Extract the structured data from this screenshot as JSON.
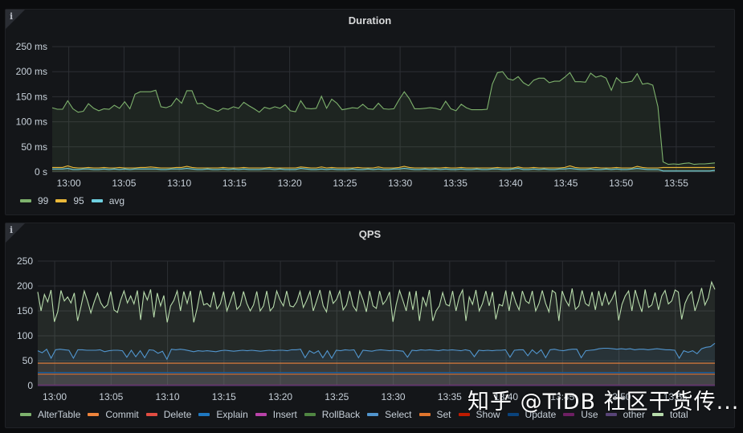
{
  "panels": [
    {
      "id": "duration",
      "title": "Duration",
      "info_icon": "info-icon",
      "legend": [
        {
          "label": "99",
          "color": "#7eb26d"
        },
        {
          "label": "95",
          "color": "#eab839"
        },
        {
          "label": "avg",
          "color": "#6ed0e0"
        }
      ]
    },
    {
      "id": "qps",
      "title": "QPS",
      "info_icon": "info-icon",
      "legend": [
        {
          "label": "AlterTable",
          "color": "#7eb26d"
        },
        {
          "label": "Commit",
          "color": "#ef843c"
        },
        {
          "label": "Delete",
          "color": "#e24d42"
        },
        {
          "label": "Explain",
          "color": "#1f78c1"
        },
        {
          "label": "Insert",
          "color": "#ba43a9"
        },
        {
          "label": "RollBack",
          "color": "#508642"
        },
        {
          "label": "Select",
          "color": "#5195ce"
        },
        {
          "label": "Set",
          "color": "#e0752d"
        },
        {
          "label": "Show",
          "color": "#bf1b00"
        },
        {
          "label": "Update",
          "color": "#0a437c"
        },
        {
          "label": "Use",
          "color": "#6d1f62"
        },
        {
          "label": "other",
          "color": "#584477"
        },
        {
          "label": "total",
          "color": "#b7dbab"
        }
      ]
    }
  ],
  "watermark": "知乎 @TiDB 社区干货传...",
  "chart_data": [
    {
      "type": "area",
      "title": "Duration",
      "xlabel": "",
      "ylabel": "",
      "x_range": [
        "12:58:30",
        "13:58:30"
      ],
      "x_ticks": [
        "13:00",
        "13:05",
        "13:10",
        "13:15",
        "13:20",
        "13:25",
        "13:30",
        "13:35",
        "13:40",
        "13:45",
        "13:50",
        "13:55"
      ],
      "y_ticks": [
        "0 s",
        "50 ms",
        "100 ms",
        "150 ms",
        "200 ms",
        "250 ms"
      ],
      "ylim": [
        0,
        250
      ],
      "y_unit": "ms",
      "grid": true,
      "legend_position": "bottom-left",
      "x_step_seconds": 30,
      "series": [
        {
          "name": "99",
          "color": "#7eb26d",
          "values": [
            128,
            125,
            125,
            142,
            126,
            119,
            121,
            136,
            127,
            122,
            126,
            125,
            133,
            127,
            140,
            126,
            155,
            160,
            160,
            160,
            163,
            130,
            128,
            132,
            147,
            137,
            162,
            162,
            136,
            137,
            129,
            125,
            121,
            127,
            125,
            130,
            127,
            139,
            132,
            126,
            119,
            129,
            126,
            130,
            127,
            134,
            122,
            120,
            142,
            127,
            126,
            127,
            151,
            127,
            145,
            137,
            124,
            126,
            128,
            127,
            135,
            126,
            125,
            137,
            126,
            125,
            126,
            144,
            160,
            146,
            126,
            126,
            127,
            128,
            127,
            124,
            141,
            126,
            122,
            135,
            128,
            124,
            124,
            124,
            125,
            175,
            198,
            200,
            186,
            183,
            190,
            178,
            172,
            183,
            187,
            187,
            178,
            181,
            181,
            189,
            198,
            180,
            180,
            179,
            197,
            189,
            192,
            187,
            163,
            188,
            178,
            179,
            181,
            196,
            175,
            177,
            173,
            130,
            20,
            15,
            16,
            15,
            17,
            18,
            15,
            16,
            16,
            17,
            18
          ]
        },
        {
          "name": "95",
          "color": "#eab839",
          "values": [
            9,
            9,
            9,
            12,
            9,
            8,
            8,
            9,
            8,
            8,
            9,
            8,
            8,
            9,
            8,
            8,
            8,
            9,
            9,
            10,
            9,
            8,
            8,
            8,
            9,
            9,
            11,
            9,
            8,
            8,
            8,
            8,
            8,
            9,
            8,
            8,
            8,
            9,
            8,
            8,
            8,
            8,
            9,
            8,
            8,
            8,
            8,
            8,
            10,
            9,
            8,
            8,
            10,
            8,
            9,
            8,
            8,
            8,
            8,
            9,
            8,
            8,
            8,
            10,
            8,
            8,
            8,
            9,
            11,
            9,
            8,
            8,
            8,
            8,
            8,
            8,
            9,
            8,
            8,
            9,
            8,
            8,
            8,
            8,
            8,
            8,
            9,
            8,
            8,
            8,
            10,
            8,
            8,
            9,
            8,
            8,
            8,
            8,
            8,
            9,
            12,
            9,
            8,
            8,
            8,
            9,
            8,
            8,
            8,
            9,
            8,
            8,
            8,
            11,
            9,
            8,
            8,
            8,
            9,
            9,
            9,
            9,
            9,
            9,
            9,
            9,
            9,
            9,
            9
          ]
        },
        {
          "name": "avg",
          "color": "#6ed0e0",
          "values": [
            6,
            6,
            6,
            7,
            5,
            5,
            6,
            6,
            5,
            5,
            6,
            5,
            6,
            5,
            6,
            5,
            6,
            6,
            6,
            6,
            6,
            5,
            5,
            6,
            6,
            6,
            7,
            6,
            5,
            5,
            6,
            5,
            5,
            6,
            5,
            6,
            5,
            6,
            5,
            5,
            5,
            6,
            6,
            5,
            6,
            5,
            5,
            5,
            7,
            6,
            5,
            5,
            6,
            5,
            6,
            5,
            5,
            5,
            6,
            5,
            5,
            6,
            5,
            6,
            5,
            5,
            6,
            6,
            7,
            6,
            5,
            5,
            6,
            5,
            6,
            5,
            6,
            5,
            5,
            6,
            5,
            5,
            6,
            5,
            5,
            6,
            6,
            5,
            5,
            6,
            7,
            5,
            5,
            6,
            5,
            6,
            5,
            5,
            6,
            6,
            7,
            6,
            5,
            5,
            6,
            5,
            5,
            6,
            5,
            6,
            5,
            5,
            6,
            7,
            6,
            5,
            5,
            5,
            2,
            2,
            2,
            2,
            2,
            2,
            2,
            2,
            2,
            2,
            3
          ]
        }
      ]
    },
    {
      "type": "area",
      "title": "QPS",
      "xlabel": "",
      "ylabel": "",
      "x_range": [
        "12:58:30",
        "13:58:30"
      ],
      "x_ticks": [
        "13:00",
        "13:05",
        "13:10",
        "13:15",
        "13:20",
        "13:25",
        "13:30",
        "13:35",
        "13:40",
        "13:45",
        "13:50",
        "13:55"
      ],
      "y_ticks": [
        "0",
        "50",
        "100",
        "150",
        "200",
        "250"
      ],
      "ylim": [
        0,
        250
      ],
      "grid": true,
      "legend_position": "bottom-left",
      "x_step_seconds": 15,
      "series": [
        {
          "name": "AlterTable",
          "color": "#7eb26d",
          "values": "constant",
          "constant": 0
        },
        {
          "name": "Delete",
          "color": "#e24d42",
          "values": "constant",
          "constant": 0
        },
        {
          "name": "RollBack",
          "color": "#508642",
          "values": "constant",
          "constant": 0
        },
        {
          "name": "Show",
          "color": "#bf1b00",
          "values": "constant",
          "constant": 0
        },
        {
          "name": "Insert",
          "color": "#ba43a9",
          "values": "constant",
          "constant": 1
        },
        {
          "name": "Use",
          "color": "#6d1f62",
          "values": "constant",
          "constant": 1
        },
        {
          "name": "other",
          "color": "#584477",
          "values": "constant",
          "constant": 0
        },
        {
          "name": "Set",
          "color": "#e0752d",
          "values": "constant",
          "constant": 23
        },
        {
          "name": "Update",
          "color": "#0a437c",
          "values": "constant",
          "constant": 25
        },
        {
          "name": "Explain",
          "color": "#1f78c1",
          "values": "constant",
          "constant": 26
        },
        {
          "name": "Commit",
          "color": "#ef843c",
          "values": "constant",
          "constant": 45
        },
        {
          "name": "Select",
          "color": "#5195ce",
          "values": [
            70,
            66,
            73,
            55,
            72,
            73,
            72,
            71,
            55,
            72,
            72,
            71,
            71,
            71,
            72,
            68,
            70,
            71,
            71,
            70,
            57,
            71,
            58,
            70,
            56,
            72,
            71,
            65,
            69,
            53,
            73,
            72,
            73,
            72,
            70,
            68,
            70,
            69,
            70,
            69,
            68,
            70,
            71,
            70,
            69,
            70,
            71,
            70,
            71,
            70,
            69,
            70,
            71,
            70,
            71,
            71,
            70,
            72,
            72,
            73,
            56,
            70,
            65,
            70,
            56,
            70,
            55,
            71,
            70,
            72,
            71,
            72,
            56,
            71,
            70,
            69,
            71,
            72,
            71,
            70,
            71,
            70,
            69,
            57,
            71,
            70,
            72,
            71,
            72,
            71,
            70,
            72,
            71,
            72,
            71,
            70,
            72,
            70,
            58,
            71,
            70,
            71,
            70,
            71,
            71,
            72,
            57,
            71,
            72,
            72,
            60,
            72,
            64,
            72,
            56,
            72,
            73,
            71,
            70,
            72,
            73,
            73,
            56,
            70,
            71,
            72,
            74,
            75,
            75,
            74,
            73,
            74,
            73,
            74,
            72,
            73,
            73,
            72,
            73,
            74,
            73,
            72,
            72,
            71,
            55,
            70,
            67,
            70,
            64,
            74,
            77,
            78,
            85
          ]
        },
        {
          "name": "total",
          "color": "#b7dbab",
          "values": [
            188,
            150,
            183,
            168,
            192,
            128,
            148,
            191,
            170,
            178,
            166,
            186,
            130,
            158,
            190,
            170,
            146,
            168,
            186,
            166,
            156,
            162,
            189,
            152,
            147,
            172,
            190,
            166,
            180,
            164,
            191,
            132,
            188,
            172,
            193,
            137,
            186,
            160,
            181,
            127,
            160,
            171,
            190,
            150,
            189,
            165,
            190,
            127,
            155,
            191,
            162,
            165,
            158,
            188,
            154,
            164,
            189,
            150,
            169,
            189,
            153,
            161,
            189,
            165,
            150,
            162,
            189,
            150,
            160,
            190,
            150,
            158,
            190,
            172,
            160,
            190,
            160,
            158,
            168,
            189,
            157,
            171,
            189,
            150,
            170,
            192,
            160,
            148,
            191,
            165,
            173,
            190,
            152,
            162,
            190,
            160,
            150,
            190,
            172,
            148,
            190,
            160,
            155,
            190,
            163,
            172,
            188,
            128,
            163,
            191,
            171,
            150,
            189,
            152,
            190,
            130,
            178,
            160,
            192,
            130,
            150,
            160,
            187,
            163,
            160,
            190,
            150,
            178,
            192,
            130,
            178,
            163,
            192,
            150,
            165,
            190,
            160,
            188,
            133,
            163,
            160,
            191,
            150,
            189,
            167,
            152,
            190,
            170,
            165,
            190,
            150,
            165,
            191,
            165,
            148,
            191,
            186,
            130,
            190,
            172,
            160,
            195,
            153,
            160,
            191,
            165,
            160,
            188,
            152,
            190,
            160,
            186,
            163,
            174,
            189,
            131,
            163,
            180,
            190,
            150,
            192,
            168,
            148,
            193,
            157,
            162,
            187,
            152,
            180,
            191,
            164,
            170,
            192,
            188,
            133,
            165,
            180,
            189,
            150,
            170,
            196,
            162,
            176,
            208,
            193
          ]
        }
      ]
    }
  ]
}
